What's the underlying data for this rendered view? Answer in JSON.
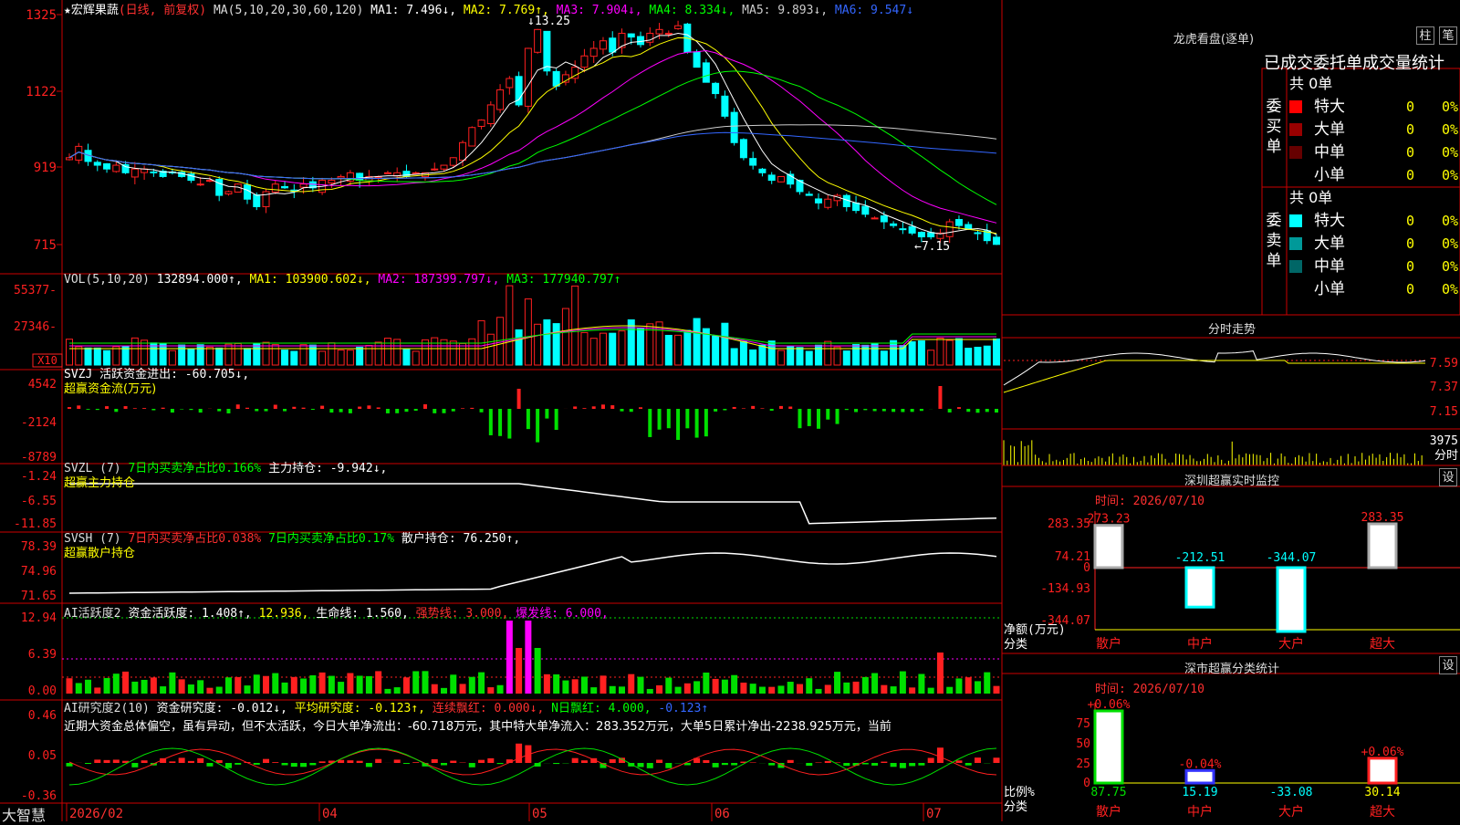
{
  "colors": {
    "up": "#ff2020",
    "down": "#00ffff",
    "ma1": "#ffffff",
    "ma2": "#ffff00",
    "ma3": "#ff00ff",
    "ma4": "#00ff00",
    "ma5": "#cccccc",
    "ma6": "#3366ff",
    "grid": "#cc0000",
    "green": "#00e000"
  },
  "header": {
    "stock": "★宏辉果蔬",
    "period": "(日线, 前复权)",
    "ma_label": "MA(5,10,20,30,60,120)",
    "ma1": "MA1: 7.496↓,",
    "ma2": "MA2: 7.769↑,",
    "ma3": "MA3: 7.904↓,",
    "ma4": "MA4: 8.334↓,",
    "ma5": "MA5: 9.893↓,",
    "ma6": "MA6: 9.547↓"
  },
  "price_axis": [
    "1325",
    "1122",
    "919",
    "715"
  ],
  "annotations": {
    "high": "13.25",
    "low": "←7.15"
  },
  "vol": {
    "label": "VOL(5,10,20)",
    "value": "132894.000↑,",
    "ma1": "MA1: 103900.602↓,",
    "ma2": "MA2: 187399.797↓,",
    "ma3": "MA3: 177940.797↑",
    "axis": [
      "55377-",
      "27346-"
    ],
    "x10": "X10"
  },
  "svzj": {
    "label": "SVZJ  活跃资金进出: -60.705↓,",
    "sub": "超赢资金流(万元)",
    "axis": [
      "4542",
      "-2124",
      "-8789"
    ]
  },
  "svzl": {
    "label": "SVZL (7)",
    "green": "7日内买卖净占比0.166%",
    "white": "主力持仓: -9.942↓,",
    "sub": "超赢主力持仓",
    "axis": [
      "-1.24",
      "-6.55",
      "-11.85"
    ]
  },
  "svsh": {
    "label": "SVSH (7)",
    "red": "7日内买卖净占比0.038%",
    "green": "7日内买卖净占比0.17%",
    "white": "散户持仓: 76.250↑,",
    "sub": "超赢散户持仓",
    "axis": [
      "78.39",
      "74.96",
      "71.65"
    ]
  },
  "ai1": {
    "label": "AI活跃度2",
    "a": "资金活跃度: 1.408↑,",
    "b": "12.936,",
    "c": "生命线: 1.560,",
    "d": "强势线: 3.000,",
    "e": "爆发线: 6.000,",
    "axis": [
      "12.94",
      "6.39",
      "0.00"
    ]
  },
  "ai2": {
    "label": "AI研究度2(10)",
    "a": "资金研究度: -0.012↓,",
    "b": "平均研究度: -0.123↑,",
    "c": "连续飘红: 0.000↓,",
    "d": "N日飘红: 4.000,",
    "e": "-0.123↑",
    "text": "近期大资金总体偏空，虽有异动，但不太活跃，今日大单净流出：-60.718万元，其中特大单净流入：283.352万元，大单5日累计净出-2238.925万元，当前",
    "axis": [
      "0.46",
      "0.05",
      "-0.36"
    ]
  },
  "xaxis": {
    "brand": "大智慧",
    "labels": [
      "2026/02",
      "04",
      "05",
      "06",
      "07"
    ]
  },
  "dragon": {
    "title": "龙虎看盘(逐单)",
    "btn1": "柱",
    "btn2": "笔",
    "subtitle": "已成交委托单成交量统计",
    "buy": {
      "side": "委买单",
      "count": "共 0单",
      "rows": [
        {
          "label": "特大",
          "v": "0",
          "p": "0%"
        },
        {
          "label": "大单",
          "v": "0",
          "p": "0%"
        },
        {
          "label": "中单",
          "v": "0",
          "p": "0%"
        },
        {
          "label": "小单",
          "v": "0",
          "p": "0%"
        }
      ]
    },
    "sell": {
      "side": "委卖单",
      "count": "共 0单",
      "rows": [
        {
          "label": "特大",
          "v": "0",
          "p": "0%"
        },
        {
          "label": "大单",
          "v": "0",
          "p": "0%"
        },
        {
          "label": "中单",
          "v": "0",
          "p": "0%"
        },
        {
          "label": "小单",
          "v": "0",
          "p": "0%"
        }
      ]
    }
  },
  "intraday": {
    "title": "分时走势",
    "axis": [
      "7.59",
      "7.37",
      "7.15"
    ],
    "vol": "3975",
    "vol_label": "分时"
  },
  "sz_monitor": {
    "title": "深圳超赢实时监控",
    "set": "设",
    "time": "时间: 2026/07/10",
    "axis": [
      "283.35",
      "74.21",
      "0",
      "-134.93",
      "-344.07"
    ],
    "ylabel": "净额(万元)",
    "xlabel": "分类",
    "cats": [
      "散户",
      "中户",
      "大户",
      "超大"
    ],
    "values": [
      273.23,
      -212.51,
      -344.07,
      283.35
    ],
    "labels": [
      "273.23",
      "-212.51",
      "-344.07",
      "283.35"
    ]
  },
  "sz_class": {
    "title": "深市超赢分类统计",
    "set": "设",
    "time": "时间: 2026/07/10",
    "axis": [
      "75",
      "50",
      "25",
      "0"
    ],
    "ylabel": "比例%",
    "xlabel": "分类",
    "cats": [
      "散户",
      "中户",
      "大户",
      "超大"
    ],
    "top_labels": [
      "+0.06%",
      "-0.04%",
      "",
      "+0.06%"
    ],
    "values": [
      87.75,
      15.19,
      -33.08,
      30.14
    ],
    "bottom": [
      "87.75",
      "15.19",
      "-33.08",
      "30.14"
    ]
  },
  "chart_data": [
    {
      "type": "candlestick",
      "title": "宏辉果蔬 日线 前复权",
      "ylim": [
        7.15,
        13.25
      ],
      "x": [
        "2026/02",
        "04",
        "05",
        "06",
        "07"
      ],
      "close": [
        9.6,
        9.9,
        9.5,
        9.4,
        9.3,
        9.4,
        9.2,
        9.3,
        9.3,
        9.2,
        9.1,
        9.2,
        9.1,
        9.0,
        8.9,
        9.0,
        8.6,
        8.7,
        8.9,
        8.5,
        8.3,
        8.7,
        8.9,
        8.8,
        8.7,
        8.9,
        8.8,
        9.0,
        9.0,
        9.1,
        9.2,
        9.0,
        9.1,
        9.1,
        9.2,
        9.2,
        9.1,
        9.2,
        9.2,
        9.3,
        9.4,
        9.6,
        10.0,
        10.4,
        10.6,
        11.0,
        11.4,
        11.7,
        11.0,
        12.5,
        13.0,
        11.9,
        11.5,
        11.8,
        12.0,
        12.3,
        12.5,
        12.7,
        12.4,
        12.9,
        12.8,
        12.6,
        12.9,
        13.0,
        12.9,
        13.1,
        12.4,
        12.0,
        11.6,
        11.3,
        10.7,
        10.0,
        9.6,
        9.4,
        9.2,
        9.0,
        9.1,
        8.9,
        8.7,
        8.6,
        8.4,
        8.5,
        8.6,
        8.3,
        8.2,
        8.1,
        8.0,
        7.9,
        7.8,
        7.7,
        7.6,
        7.5,
        7.5,
        7.6,
        7.9,
        7.8,
        7.7,
        7.6,
        7.4,
        7.3
      ],
      "ma_note": "MA1..MA6 drawn from header values"
    }
  ]
}
